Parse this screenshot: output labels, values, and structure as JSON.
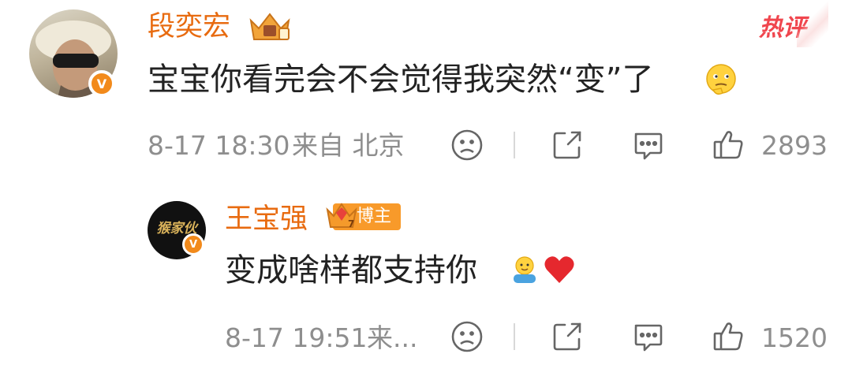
{
  "comment": {
    "username": "段奕宏",
    "text": "宝宝你看完会不会觉得我突然“变”了",
    "hot_label": "热评",
    "time": "8-17 18:30",
    "source": "来自 北京",
    "likes": "2893",
    "avatar_icon": "user-photo-avatar",
    "badge_icon": "verified-v-icon",
    "crown_icon": "vip-crown-icon",
    "emoji_icon": "thinking-emoji"
  },
  "reply": {
    "username": "王宝强",
    "tag": "博主",
    "text": "变成啥样都支持你",
    "time": "8-17 19:51",
    "source": "来...",
    "likes": "1520",
    "avatar_text": "猴家伙",
    "emoji_icons": [
      "hug-emoji",
      "red-heart-emoji"
    ]
  },
  "colors": {
    "username": "#e86b10",
    "hot": "#f0464e",
    "meta": "#8e8e8e",
    "badge": "#f28a1b"
  }
}
